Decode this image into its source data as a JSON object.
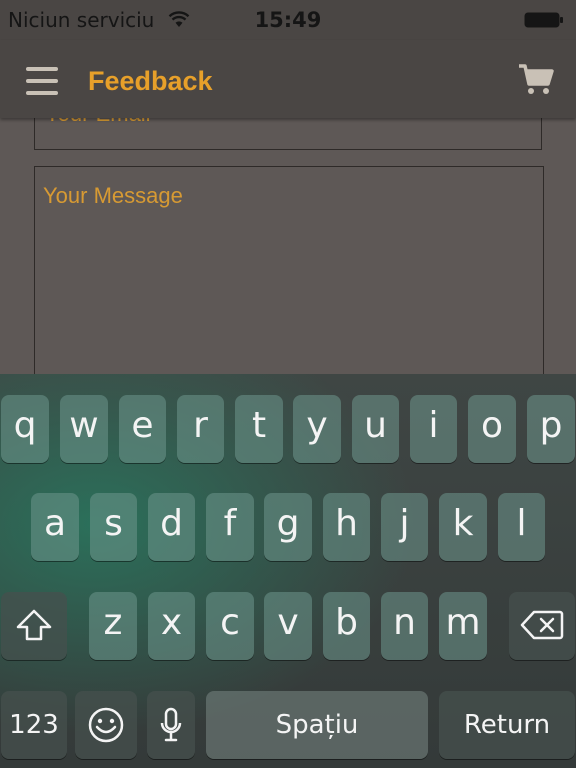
{
  "status": {
    "carrier": "Niciun serviciu",
    "time": "15:49"
  },
  "nav": {
    "title": "Feedback"
  },
  "form": {
    "email_placeholder": "Your Email",
    "message_placeholder": "Your Message"
  },
  "keyboard": {
    "row1": [
      "q",
      "w",
      "e",
      "r",
      "t",
      "y",
      "u",
      "i",
      "o",
      "p"
    ],
    "row2": [
      "a",
      "s",
      "d",
      "f",
      "g",
      "h",
      "j",
      "k",
      "l"
    ],
    "row3": [
      "z",
      "x",
      "c",
      "v",
      "b",
      "n",
      "m"
    ],
    "numbers_label": "123",
    "space_label": "Spațiu",
    "return_label": "Return"
  },
  "colors": {
    "accent": "#e7a02a",
    "nav_bg": "#4a4644",
    "content_bg": "#5e5856"
  }
}
